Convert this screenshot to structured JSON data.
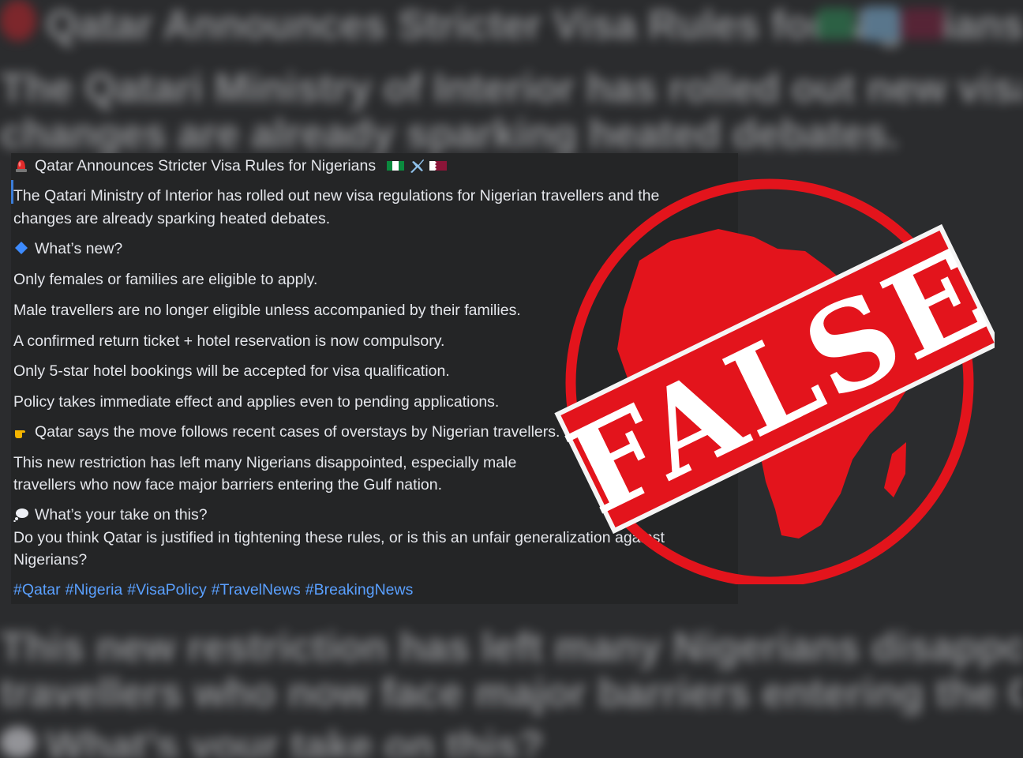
{
  "post": {
    "title": "Qatar Announces Stricter Visa Rules for Nigerians",
    "intro_1": "The Qatari Ministry of Interior has rolled out new visa regulations for Nigerian travellers and the",
    "intro_2": "changes are already sparking heated debates.",
    "whats_new": "What’s new?",
    "rule_1": "Only females or families are eligible to apply.",
    "rule_2": "Male travellers are no longer eligible  unless accompanied by their families.",
    "rule_3": "A confirmed return ticket + hotel reservation is now compulsory.",
    "rule_4": "Only 5-star hotel bookings will be accepted for visa qualification.",
    "rule_5": "Policy takes immediate effect and applies even to pending applications.",
    "reason": "Qatar says the move follows recent cases of overstays by Nigerian travellers.",
    "impact_1": "This new restriction has left many Nigerians disappointed, especially male",
    "impact_2": "travellers who now face major barriers entering the Gulf nation.",
    "question_heading": "What’s your take on this?",
    "question_1": "Do you think Qatar is justified in tightening these rules, or is this an unfair generalization against",
    "question_2": "Nigerians?",
    "hashtags": [
      "#Qatar",
      "#Nigeria",
      "#VisaPolicy",
      "#TravelNews",
      "#BreakingNews"
    ]
  },
  "background": {
    "line_1": "Qatar Announces Stricter Visa Rules for Nigerians",
    "line_2": "The Qatari Ministry of Interior has rolled out new visa regulations fo",
    "line_3": "changes are already sparking heated debates.",
    "line_4": "This new restriction has left many Nigerians disappointed, especial",
    "line_5": "travellers who now face major barriers entering the Gulf nation.",
    "line_6": "What’s your take on this?"
  },
  "stamp": {
    "label": "FALSE",
    "color": "#e3141c"
  },
  "icons": {
    "siren": "police-light-icon",
    "nigeria_flag": "nigeria-flag-icon",
    "airplane": "airplane-icon",
    "qatar_flag": "qatar-flag-icon",
    "diamond": "blue-diamond-icon",
    "pointing": "pointing-hand-icon",
    "thought": "thought-balloon-icon"
  }
}
